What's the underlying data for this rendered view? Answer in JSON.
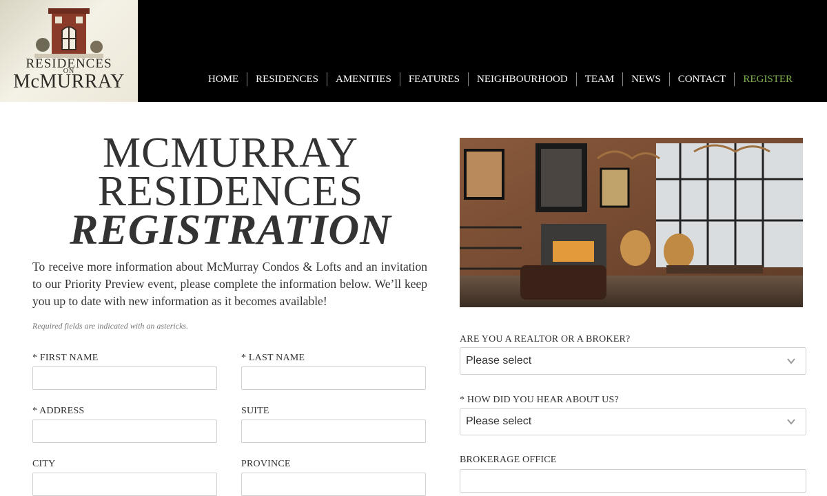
{
  "logo": {
    "line1": "RESIDENCES",
    "line2": "ON",
    "line3": "McMURRAY"
  },
  "nav": {
    "items": [
      "HOME",
      "RESIDENCES",
      "AMENITIES",
      "FEATURES",
      "NEIGHBOURHOOD",
      "TEAM",
      "NEWS",
      "CONTACT",
      "REGISTER"
    ],
    "active": "REGISTER",
    "active_color": "#7db24a"
  },
  "page": {
    "title_line1": "MCMURRAY",
    "title_line2": "RESIDENCES",
    "title_line3": "REGISTRATION",
    "intro": "To receive more information about McMurray Condos & Lofts and an invitation to our Priority Preview event, please complete the information below. We’ll keep you up to date with new information as it becomes available!",
    "required_note": "Required fields are indicated with an astericks."
  },
  "form": {
    "first_name_label": "* FIRST NAME",
    "last_name_label": "* LAST NAME",
    "address_label": "* ADDRESS",
    "suite_label": "SUITE",
    "city_label": "CITY",
    "province_label": "PROVINCE",
    "realtor_label": "ARE YOU A REALTOR OR A BROKER?",
    "realtor_value": "Please select",
    "hear_label": "* HOW DID YOU HEAR ABOUT US?",
    "hear_value": "Please select",
    "brokerage_label": "BROKERAGE OFFICE"
  },
  "icons": {
    "dropdown": "chevron-down-icon",
    "hero": "living-room-photo"
  }
}
